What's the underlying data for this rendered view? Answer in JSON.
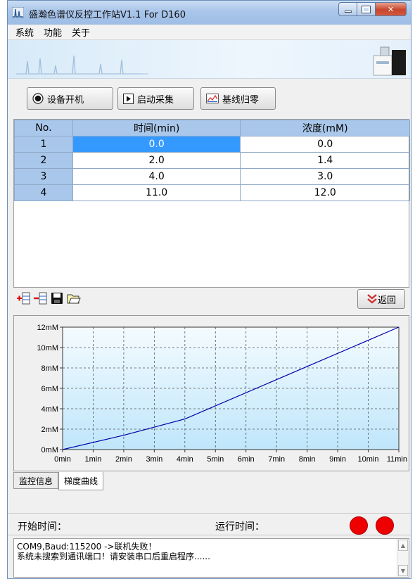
{
  "window": {
    "title": "盛瀚色谱仪反控工作站V1.1 For D160",
    "accent": "#a9c5ea"
  },
  "menu": [
    "系统",
    "功能",
    "关于"
  ],
  "toolbar": {
    "power_label": "设备开机",
    "acquire_label": "启动采集",
    "baseline_label": "基线归零"
  },
  "table": {
    "headers": [
      "No.",
      "时间(min)",
      "浓度(mM)"
    ],
    "rows": [
      [
        "1",
        "0.0",
        "0.0"
      ],
      [
        "2",
        "2.0",
        "1.4"
      ],
      [
        "3",
        "4.0",
        "3.0"
      ],
      [
        "4",
        "11.0",
        "12.0"
      ]
    ],
    "selected_color": "#3399ff"
  },
  "back_label": "返回",
  "chart_data": {
    "type": "line",
    "x": [
      0,
      2,
      4,
      11
    ],
    "series": [
      {
        "values": [
          0,
          1.4,
          3,
          12
        ],
        "color": "#0000aa"
      }
    ],
    "x_ticks": [
      "0min",
      "1min",
      "2min",
      "3min",
      "4min",
      "5min",
      "6min",
      "7min",
      "8min",
      "9min",
      "10min",
      "11min"
    ],
    "y_ticks": [
      "0mM",
      "2mM",
      "4mM",
      "6mM",
      "8mM",
      "10mM",
      "12mM"
    ],
    "xlim": [
      0,
      11
    ],
    "ylim": [
      0,
      12
    ],
    "grid": true
  },
  "tabs": [
    "监控信息",
    "梯度曲线"
  ],
  "status": {
    "start_label": "开始时间：",
    "run_label": "运行时间："
  },
  "indicator_color": "#ee0000",
  "log": [
    "COM9,Baud:115200 ->联机失败！",
    "系统未搜索到通讯端口！请安装串口后重启程序......"
  ]
}
